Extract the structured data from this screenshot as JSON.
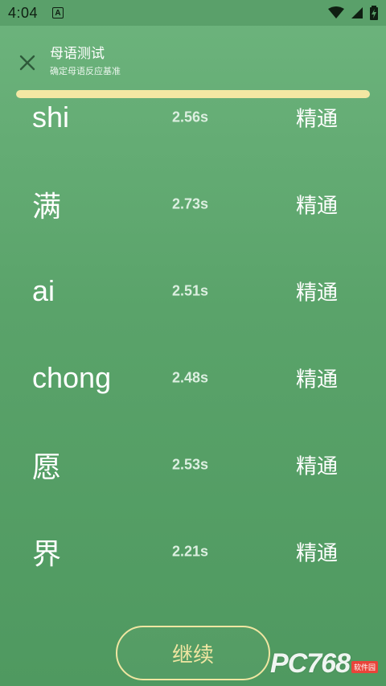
{
  "status_bar": {
    "time": "4:04",
    "notification_letter": "A"
  },
  "header": {
    "title": "母语测试",
    "subtitle": "确定母语反应基准"
  },
  "progress": {
    "fraction": 1.0
  },
  "results": [
    {
      "word": "shi",
      "time": "2.56s",
      "level": "精通"
    },
    {
      "word": "满",
      "time": "2.73s",
      "level": "精通"
    },
    {
      "word": "ai",
      "time": "2.51s",
      "level": "精通"
    },
    {
      "word": "chong",
      "time": "2.48s",
      "level": "精通"
    },
    {
      "word": "愿",
      "time": "2.53s",
      "level": "精通"
    },
    {
      "word": "界",
      "time": "2.21s",
      "level": "精通"
    }
  ],
  "continue_label": "继续",
  "watermark": {
    "text": "PC768",
    "sub": "软件园"
  },
  "colors": {
    "accent": "#f0e6a2",
    "background": "#5aa36a"
  }
}
